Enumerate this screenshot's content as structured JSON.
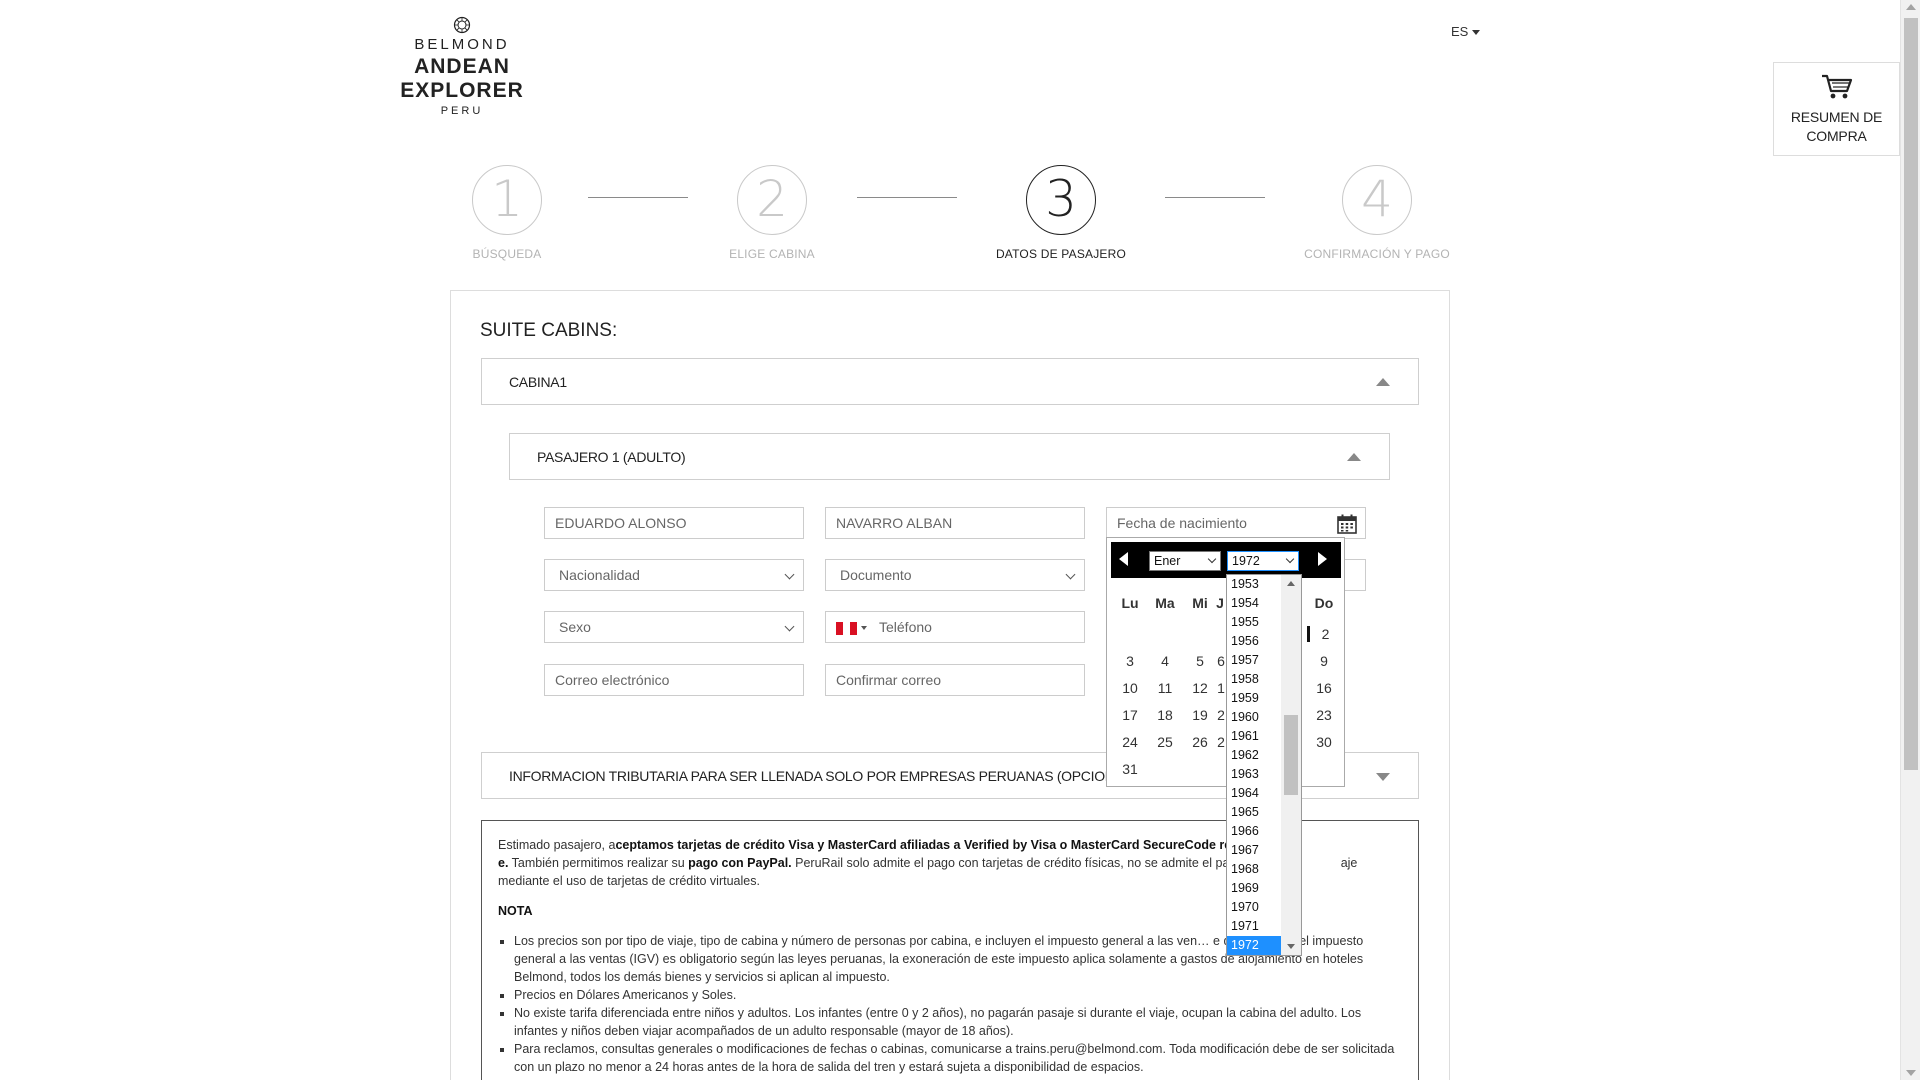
{
  "brand": {
    "line1": "BELMOND",
    "line2": "ANDEAN EXPLORER",
    "line3": "PERU"
  },
  "language": "ES",
  "cart": {
    "label_line1": "RESUMEN DE",
    "label_line2": "COMPRA",
    "icon": "cart-icon"
  },
  "steps": [
    {
      "number": "1",
      "label": "BÚSQUEDA",
      "active": false
    },
    {
      "number": "2",
      "label": "ELIGE CABINA",
      "active": false
    },
    {
      "number": "3",
      "label": "DATOS DE PASAJERO",
      "active": true
    },
    {
      "number": "4",
      "label": "CONFIRMACIÓN Y PAGO",
      "active": false
    }
  ],
  "section_title": "SUITE CABINS:",
  "cabin_header": "CABINA1",
  "passenger_header": "PASAJERO 1 (ADULTO)",
  "form": {
    "first_name": "EDUARDO ALONSO",
    "last_name": "NAVARRO ALBAN",
    "birthdate_placeholder": "Fecha de nacimiento",
    "nationality": "Nacionalidad",
    "document": "Documento",
    "sex": "Sexo",
    "phone_placeholder": "Teléfono",
    "email_placeholder": "Correo electrónico",
    "confirm_email_placeholder": "Confirmar correo"
  },
  "tax_header": "INFORMACION TRIBUTARIA PARA SER LLENADA SOLO POR EMPRESAS PERUANAS (OPCIONAL)",
  "notice": {
    "p1_a": "Estimado pasajero, a",
    "p1_b": "ceptamos tarjetas de crédito Visa y MasterCard afiliadas a Verified by Visa o MasterCard SecureCode res",
    "p1_c": "e.",
    "p1_d": " También permitimos realizar su ",
    "p1_e": "pago con PayPal.",
    "p1_f": " PeruRail solo admite el pago con tarjetas de crédito físicas, no se admite el pago de",
    "p1_g": "aje mediante el uso de tarjetas de crédito virtuales.",
    "nota": "NOTA",
    "items": [
      "Los precios son por tipo de viaje, tipo de cabina y número de personas por cabina, e incluyen el impuesto general a las ven… e que el pago del impuesto general a las ventas (IGV) es obligatorio según las leyes peruanas, la exoneración de este impuesto aplica solamente a gastos de alojamiento en hoteles Belmond, todos los demás bienes y servicios si aplican al impuesto.",
      "Precios en Dólares Americanos y Soles.",
      "No existe tarifa diferenciada entre niños y adultos. Los infantes (entre 0 y 2 años), no pagarán pasaje si durante el viaje, ocupan la cabina del adulto. Los infantes y niños deben viajar acompañados de un adulto responsable (mayor de 18 años).",
      "Para reclamos, consultas generales o modificaciones de fechas o cabinas, comunicarse a trains.peru@belmond.com. Toda modificación debe de ser solicitada con un plazo no menor a 24 horas antes de la hora de salida del tren y estará sujeta a disponibilidad de espacios."
    ]
  },
  "datepicker": {
    "month": "Ener",
    "year": "1972",
    "weekdays": [
      "Lu",
      "Ma",
      "Mi",
      "J",
      "Do"
    ],
    "days": [
      "2",
      "3",
      "4",
      "5",
      "6",
      "1",
      "9",
      "10",
      "11",
      "12",
      "1",
      "16",
      "17",
      "18",
      "19",
      "2",
      "23",
      "24",
      "25",
      "26",
      "2",
      "30",
      "31"
    ],
    "years": [
      "1953",
      "1954",
      "1955",
      "1956",
      "1957",
      "1958",
      "1959",
      "1960",
      "1961",
      "1962",
      "1963",
      "1964",
      "1965",
      "1966",
      "1967",
      "1968",
      "1969",
      "1970",
      "1971",
      "1972"
    ],
    "selected_year": "1972",
    "selected_color": "#1e90ff"
  }
}
